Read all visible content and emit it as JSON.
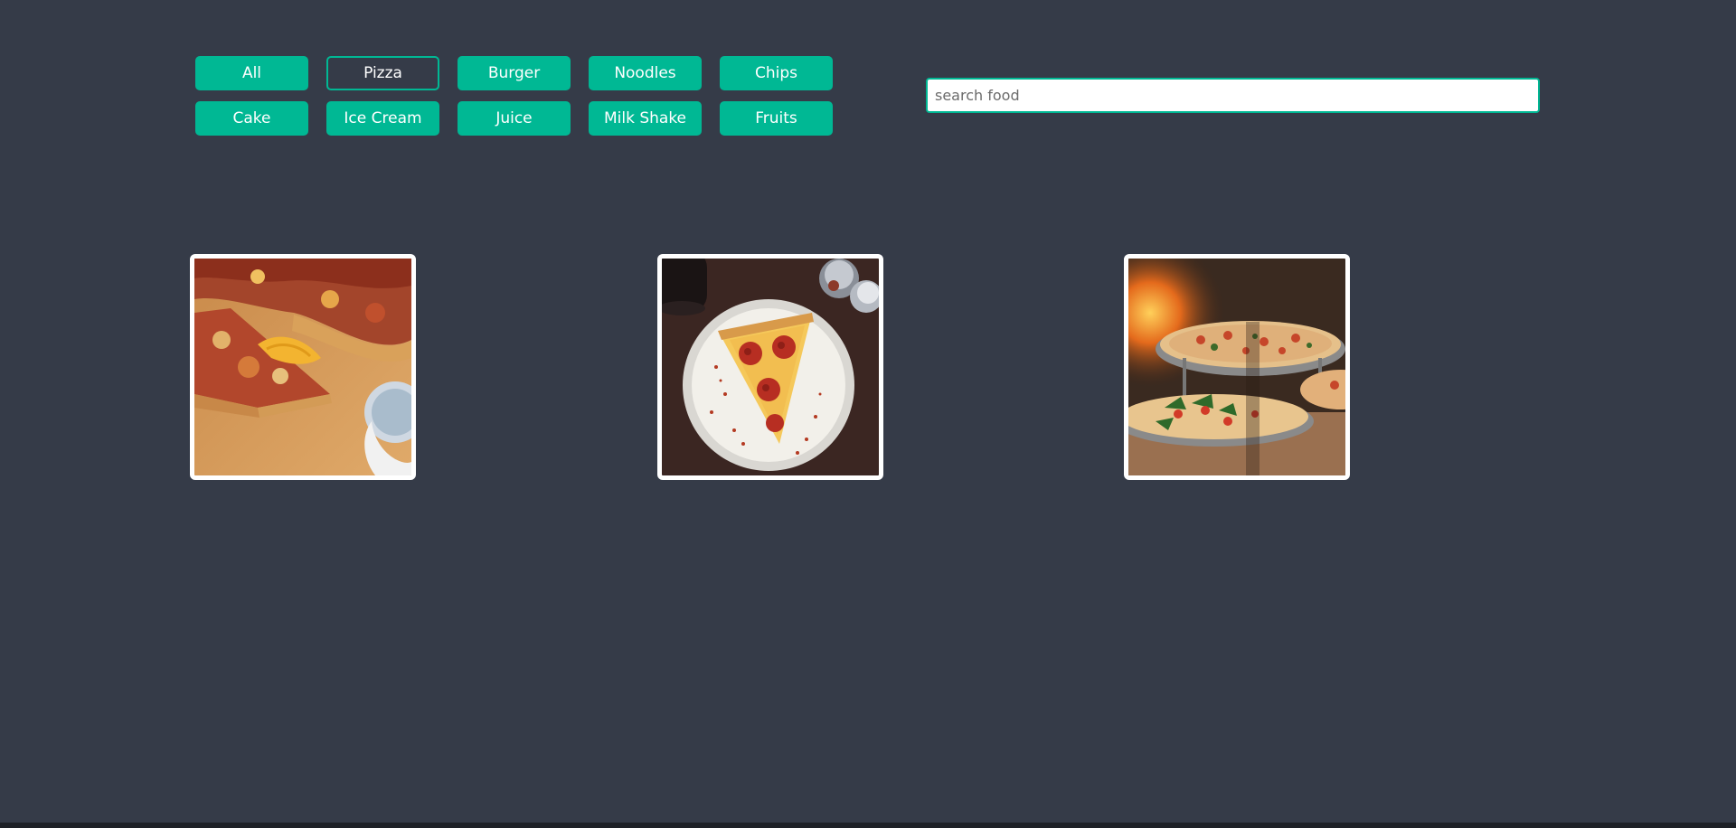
{
  "filters": {
    "row1": [
      "All",
      "Pizza",
      "Burger",
      "Noodles",
      "Chips"
    ],
    "row2": [
      "Cake",
      "Ice Cream",
      "Juice",
      "Milk Shake",
      "Fruits"
    ],
    "active": "Pizza"
  },
  "search": {
    "placeholder": "search food",
    "value": ""
  },
  "colors": {
    "background": "#353b48",
    "accent": "#00b894",
    "card_border": "#ffffff"
  },
  "results": [
    {
      "category": "Pizza",
      "image": "pizza-slices-on-board"
    },
    {
      "category": "Pizza",
      "image": "pepperoni-slice-on-plate"
    },
    {
      "category": "Pizza",
      "image": "pizzas-on-stands"
    }
  ]
}
